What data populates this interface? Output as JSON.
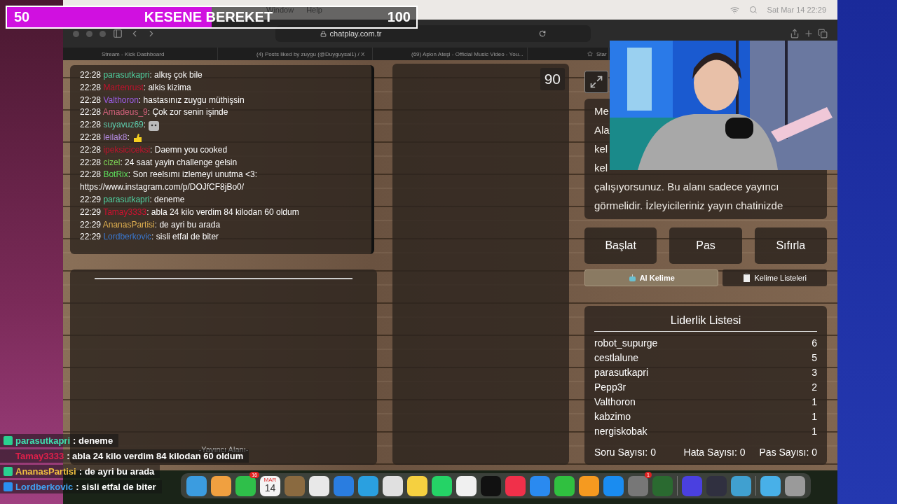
{
  "goal_bar": {
    "start": "50",
    "title": "KESENE BEREKET",
    "end": "100",
    "level": 0.5
  },
  "menu_bar": {
    "items": [
      "Window",
      "Help"
    ],
    "clock": "Sat Mar 14  22:29"
  },
  "browser": {
    "address": "chatplay.com.tr",
    "tabs": [
      {
        "label": "Stream - Kick Dashboard",
        "selected": false
      },
      {
        "label": "(4) Posts liked by zuygu (@Duyguysal1) / X",
        "selected": false
      },
      {
        "label": "(69) Aşkın Ateşi - Official Music Video - You...",
        "selected": false
      },
      {
        "label": "Star",
        "selected": false
      }
    ]
  },
  "chat": [
    {
      "time": "22:28",
      "user": "parasutkapri",
      "color": "#4fd1a0",
      "kind": "text",
      "message": ": alkış çok bile"
    },
    {
      "time": "22:28",
      "user": "Martenrust",
      "color": "#c0122c",
      "kind": "text",
      "message": ": alkis kizima"
    },
    {
      "time": "22:28",
      "user": "Valthoron",
      "color": "#9b5de5",
      "kind": "text",
      "message": ": hastasınız zuygu müthişsin"
    },
    {
      "time": "22:28",
      "user": "Amadeus_9",
      "color": "#d0607a",
      "kind": "text",
      "message": ": Çok zor senin işinde"
    },
    {
      "time": "22:28",
      "user": "suyavuz69",
      "color": "#5ed0b0",
      "kind": "cat",
      "message": ":"
    },
    {
      "time": "22:28",
      "user": "leilak8",
      "color": "#b48ae0",
      "kind": "pika",
      "message": ":"
    },
    {
      "time": "22:28",
      "user": "ipeksiciceksi",
      "color": "#c0122c",
      "kind": "text",
      "message": ": Daemn you cooked"
    },
    {
      "time": "22:28",
      "user": "cizel",
      "color": "#7ed957",
      "kind": "text",
      "message": ": 24 saat yayin challenge gelsin"
    },
    {
      "time": "22:28",
      "user": "BotRix",
      "color": "#5ee05e",
      "kind": "text",
      "message": ": Son reelsımı izlemeyi unutma <3: https://www.instagram.com/p/DOJfCF8jBo0/"
    },
    {
      "time": "22:29",
      "user": "parasutkapri",
      "color": "#4fd1a0",
      "kind": "text",
      "message": ": deneme"
    },
    {
      "time": "22:29",
      "user": "Tamay3333",
      "color": "#d01030",
      "kind": "text",
      "message": ": abla 24 kilo verdim 84 kilodan 60 oldum"
    },
    {
      "time": "22:29",
      "user": "AnanasPartisi",
      "color": "#e0b050",
      "kind": "text",
      "message": ": de ayri bu arada"
    },
    {
      "time": "22:29",
      "user": "Lordberkovic",
      "color": "#3a78d0",
      "kind": "text",
      "message": ": sisli etfal de biter"
    }
  ],
  "streamer_area": {
    "label": "-Yayıncı Alanı-"
  },
  "timer": "90",
  "info_lines": [
    "Me",
    "Ala",
    "kel",
    "kel",
    "çalışıyorsunuz. Bu alanı sadece yayıncı",
    "görmelidir. İzleyicileriniz yayın chatinizde"
  ],
  "buttons": [
    "Başlat",
    "Pas",
    "Sıfırla"
  ],
  "tool_buttons": [
    {
      "label": "AI Kelime",
      "kind": "robot",
      "selected": true
    },
    {
      "label": "Kelime Listeleri",
      "kind": "clipboard",
      "selected": false
    }
  ],
  "leaderboard": {
    "title": "Liderlik Listesi",
    "rows": [
      {
        "name": "robot_supurge",
        "score": "6"
      },
      {
        "name": "cestlalune",
        "score": "5"
      },
      {
        "name": "parasutkapri",
        "score": "3"
      },
      {
        "name": "Pepp3r",
        "score": "2"
      },
      {
        "name": "Valthoron",
        "score": "1"
      },
      {
        "name": "kabzimo",
        "score": "1"
      },
      {
        "name": "nergiskobak",
        "score": "1"
      }
    ],
    "stats": [
      "Soru Sayısı: 0",
      "Hata Sayısı: 0",
      "Pas Sayısı: 0"
    ]
  },
  "overlay_chat": [
    {
      "user": "parasutkapri",
      "color": "#3ee0b0",
      "kind": "green_badge",
      "message": ": deneme"
    },
    {
      "user": "Tamay3333",
      "color": "#e0204a",
      "kind": "plain",
      "message": ": abla 24 kilo verdim 84 kilodan 60 oldum"
    },
    {
      "user": "AnanasPartisi",
      "color": "#f0c040",
      "kind": "green_badge",
      "message": ": de ayri bu arada"
    },
    {
      "user": "Lordberkovic",
      "color": "#40a0f0",
      "kind": "blue_badge",
      "message": ": sisli etfal de biter"
    }
  ],
  "dock": [
    {
      "kind": "app",
      "color": "#3b9ce0"
    },
    {
      "kind": "app",
      "color": "#f0a040"
    },
    {
      "kind": "app",
      "color": "#2fbf4a",
      "badge": "16"
    },
    {
      "kind": "calendar",
      "month": "MAR",
      "day": "14"
    },
    {
      "kind": "app",
      "color": "#8a6a40"
    },
    {
      "kind": "app",
      "color": "#e8e8e8"
    },
    {
      "kind": "app",
      "color": "#2a7de0"
    },
    {
      "kind": "app",
      "color": "#2aa0e0"
    },
    {
      "kind": "app",
      "color": "#e0e0e0"
    },
    {
      "kind": "app",
      "color": "#f5d040"
    },
    {
      "kind": "app",
      "color": "#25d366"
    },
    {
      "kind": "app",
      "color": "#f0f0f0"
    },
    {
      "kind": "app",
      "color": "#111111"
    },
    {
      "kind": "app",
      "color": "#f0304a"
    },
    {
      "kind": "app",
      "color": "#2a8af0"
    },
    {
      "kind": "app",
      "color": "#30c040"
    },
    {
      "kind": "app",
      "color": "#f59a20"
    },
    {
      "kind": "app",
      "color": "#1a8cf0"
    },
    {
      "kind": "app",
      "color": "#777777",
      "badge": "1"
    },
    {
      "kind": "app",
      "color": "#2a6a30"
    },
    {
      "kind": "divider"
    },
    {
      "kind": "app",
      "color": "#4a40e0"
    },
    {
      "kind": "app",
      "color": "#303040"
    },
    {
      "kind": "app",
      "color": "#40a0d0"
    },
    {
      "kind": "divider"
    },
    {
      "kind": "app",
      "color": "#48b0e8"
    },
    {
      "kind": "app",
      "color": "#9a9a9a"
    }
  ]
}
